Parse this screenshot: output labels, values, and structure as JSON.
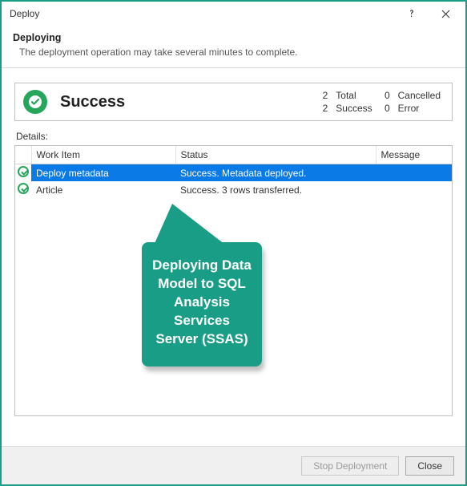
{
  "window": {
    "title": "Deploy"
  },
  "header": {
    "title": "Deploying",
    "subtitle": "The deployment operation may take several minutes to complete."
  },
  "summary": {
    "status_label": "Success",
    "counts": {
      "total_n": "2",
      "total_l": "Total",
      "cancelled_n": "0",
      "cancelled_l": "Cancelled",
      "success_n": "2",
      "success_l": "Success",
      "error_n": "0",
      "error_l": "Error"
    }
  },
  "details": {
    "label": "Details:",
    "columns": {
      "work_item": "Work Item",
      "status": "Status",
      "message": "Message"
    },
    "rows": [
      {
        "icon": "ok",
        "work_item": "Deploy metadata",
        "status": "Success. Metadata deployed.",
        "message": "",
        "selected": true
      },
      {
        "icon": "ok",
        "work_item": "Article",
        "status": "Success. 3 rows transferred.",
        "message": "",
        "selected": false
      }
    ]
  },
  "footer": {
    "stop_label": "Stop Deployment",
    "close_label": "Close"
  },
  "callout": {
    "text": "Deploying Data Model to SQL Analysis Services Server (SSAS)"
  }
}
